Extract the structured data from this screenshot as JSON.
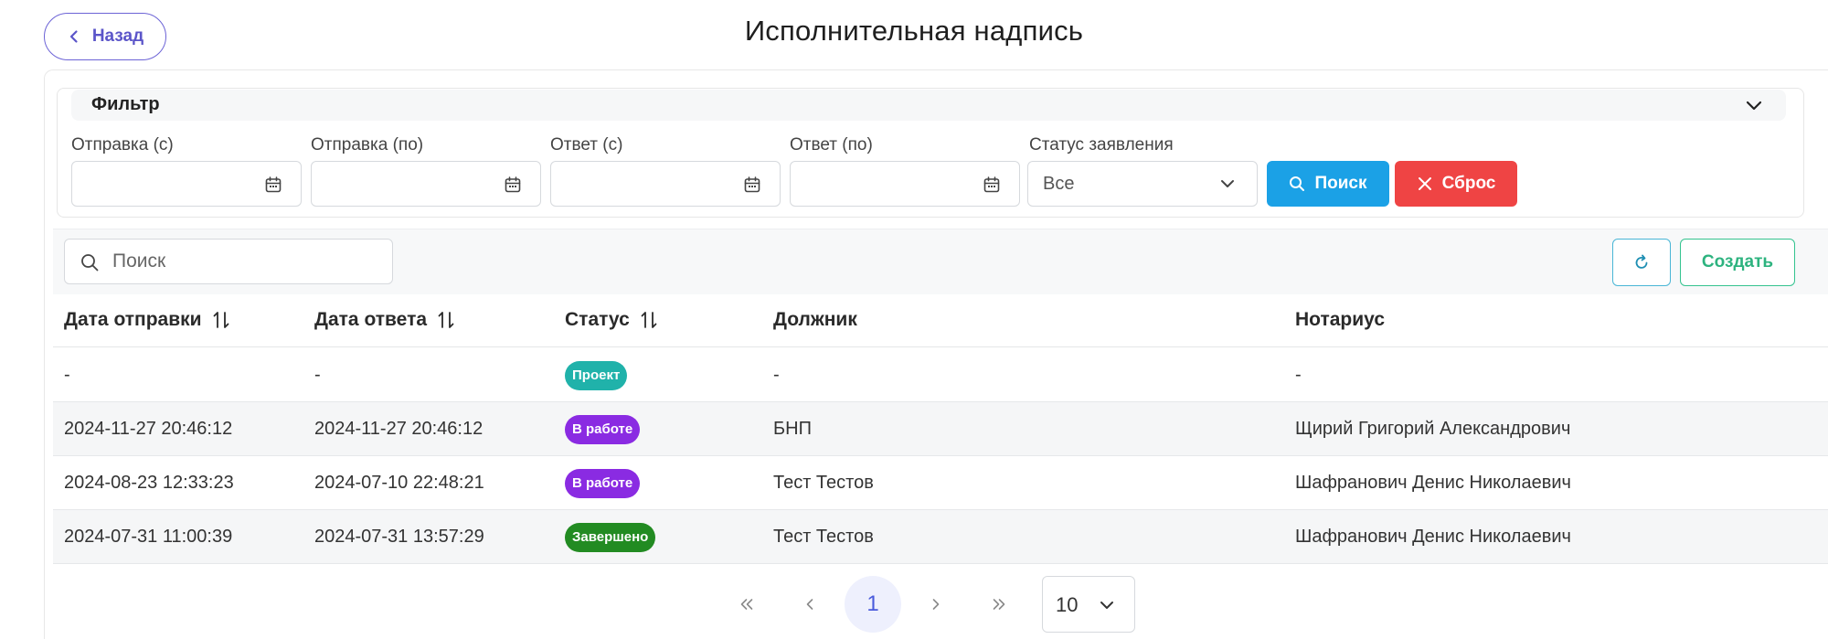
{
  "header": {
    "back_label": "Назад",
    "title": "Исполнительная надпись"
  },
  "filter": {
    "title": "Фильтр",
    "fields": [
      {
        "label": "Отправка (с)",
        "value": ""
      },
      {
        "label": "Отправка (по)",
        "value": ""
      },
      {
        "label": "Ответ (с)",
        "value": ""
      },
      {
        "label": "Ответ (по)",
        "value": ""
      }
    ],
    "status_label": "Статус заявления",
    "status_value": "Все",
    "search_button": "Поиск",
    "reset_button": "Сброс"
  },
  "toolbar": {
    "search_placeholder": "Поиск",
    "create_button": "Создать"
  },
  "table": {
    "columns": [
      "Дата отправки",
      "Дата ответа",
      "Статус",
      "Должник",
      "Нотариус"
    ],
    "rows": [
      {
        "sent": "-",
        "answered": "-",
        "status": "Проект",
        "status_color": "#20b2aa",
        "debtor": "-",
        "notary": "-"
      },
      {
        "sent": "2024-11-27 20:46:12",
        "answered": "2024-11-27 20:46:12",
        "status": "В работе",
        "status_color": "#8a2be2",
        "debtor": "БНП",
        "notary": "Щирий Григорий Александрович"
      },
      {
        "sent": "2024-08-23 12:33:23",
        "answered": "2024-07-10 22:48:21",
        "status": "В работе",
        "status_color": "#8a2be2",
        "debtor": "Тест Тестов",
        "notary": "Шафранович Денис Николаевич"
      },
      {
        "sent": "2024-07-31 11:00:39",
        "answered": "2024-07-31 13:57:29",
        "status": "Завершено",
        "status_color": "#228b22",
        "debtor": "Тест Тестов",
        "notary": "Шафранович Денис Николаевич"
      }
    ]
  },
  "pagination": {
    "current_page": "1",
    "page_size": "10"
  },
  "colors": {
    "accent": "#1ba1e6",
    "danger": "#ef4444",
    "success": "#34c38f",
    "brand": "#5b55c9"
  }
}
